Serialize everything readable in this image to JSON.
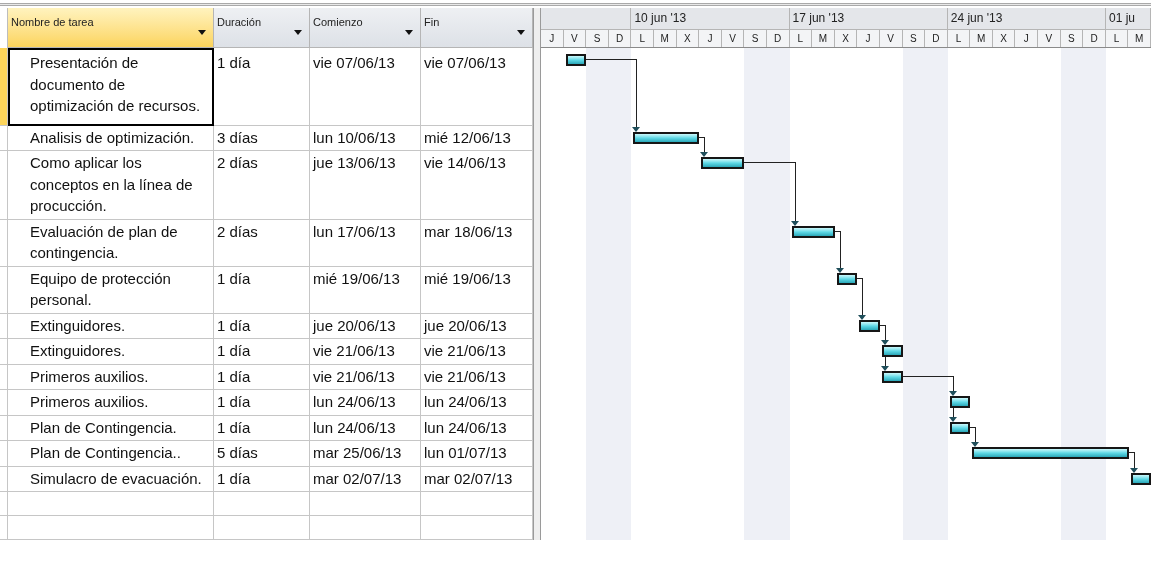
{
  "columns": [
    {
      "label": "Nombre de tarea",
      "selected": true
    },
    {
      "label": "Duración",
      "selected": false
    },
    {
      "label": "Comienzo",
      "selected": false
    },
    {
      "label": "Fin",
      "selected": false
    }
  ],
  "tasks": [
    {
      "name": "Presentación de documento de optimización de recursos.",
      "duration": "1 día",
      "start": "vie 07/06/13",
      "finish": "vie 07/06/13",
      "selected": true
    },
    {
      "name": "Analisis de optimización.",
      "duration": "3 días",
      "start": "lun 10/06/13",
      "finish": "mié 12/06/13",
      "selected": false
    },
    {
      "name": "Como aplicar los conceptos en la línea de procucción.",
      "duration": "2 días",
      "start": "jue 13/06/13",
      "finish": "vie 14/06/13",
      "selected": false
    },
    {
      "name": "Evaluación de plan de contingencia.",
      "duration": "2 días",
      "start": "lun 17/06/13",
      "finish": "mar 18/06/13",
      "selected": false
    },
    {
      "name": "Equipo de protección personal.",
      "duration": "1 día",
      "start": "mié 19/06/13",
      "finish": "mié 19/06/13",
      "selected": false
    },
    {
      "name": "Extinguidores.",
      "duration": "1 día",
      "start": "jue 20/06/13",
      "finish": "jue 20/06/13",
      "selected": false
    },
    {
      "name": "Extinguidores.",
      "duration": "1 día",
      "start": "vie 21/06/13",
      "finish": "vie 21/06/13",
      "selected": false
    },
    {
      "name": "Primeros auxilios.",
      "duration": "1 día",
      "start": "vie 21/06/13",
      "finish": "vie 21/06/13",
      "selected": false
    },
    {
      "name": "Primeros auxilios.",
      "duration": "1 día",
      "start": "lun 24/06/13",
      "finish": "lun 24/06/13",
      "selected": false
    },
    {
      "name": "Plan de Contingencia.",
      "duration": "1 día",
      "start": "lun 24/06/13",
      "finish": "lun 24/06/13",
      "selected": false
    },
    {
      "name": "Plan de Contingencia..",
      "duration": "5 días",
      "start": "mar 25/06/13",
      "finish": "lun 01/07/13",
      "selected": false
    },
    {
      "name": "Simulacro de evacuación.",
      "duration": "1 día",
      "start": "mar 02/07/13",
      "finish": "mar 02/07/13",
      "selected": false
    }
  ],
  "timescale": {
    "weeks": [
      "10 jun '13",
      "17 jun '13",
      "24 jun '13",
      "01 ju"
    ],
    "days": [
      "J",
      "V",
      "S",
      "D",
      "L",
      "M",
      "X",
      "J",
      "V",
      "S",
      "D",
      "L",
      "M",
      "X",
      "J",
      "V",
      "S",
      "D",
      "L",
      "M",
      "X",
      "J",
      "V",
      "S",
      "D",
      "L",
      "M"
    ]
  }
}
